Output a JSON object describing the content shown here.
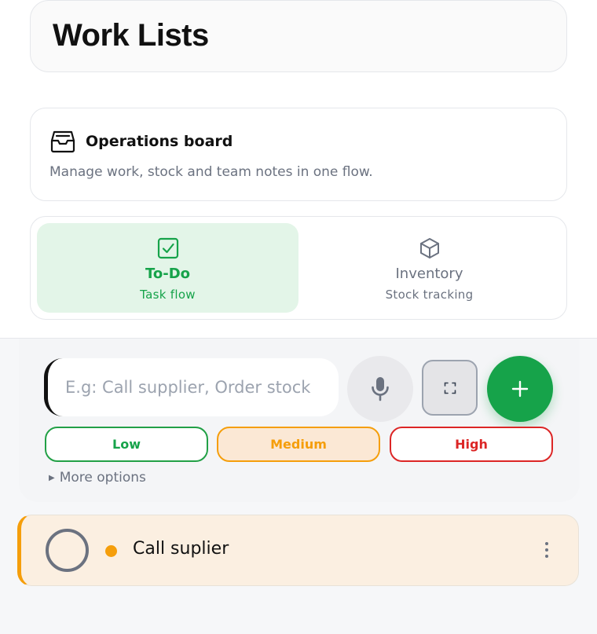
{
  "header": {
    "title": "Work Lists"
  },
  "info": {
    "icon": "inbox-tray-icon",
    "title": "Operations board",
    "description": "Manage work, stock and team notes in one flow."
  },
  "tabs": [
    {
      "icon": "checkbox-icon",
      "label": "To-Do",
      "sub": "Task flow",
      "active": true
    },
    {
      "icon": "cube-icon",
      "label": "Inventory",
      "sub": "Stock tracking",
      "active": false
    }
  ],
  "composer": {
    "placeholder": "E.g: Call supplier, Order stock",
    "value": "",
    "mic_icon": "microphone-icon",
    "expand_icon": "expand-icon",
    "add_icon": "plus-icon",
    "priorities": [
      {
        "label": "Low",
        "color": "#16a34a",
        "selected": false
      },
      {
        "label": "Medium",
        "color": "#f59e0b",
        "selected": true
      },
      {
        "label": "High",
        "color": "#dc2626",
        "selected": false
      }
    ],
    "more_options": "More options"
  },
  "tasks": [
    {
      "title": "Call suplier",
      "priority": "Medium",
      "priority_color": "#f59e0b",
      "done": false,
      "menu_icon": "more-vertical-icon"
    }
  ],
  "colors": {
    "accent": "#16a34a",
    "tab_active_bg": "#e3f5e8",
    "medium": "#f59e0b"
  }
}
